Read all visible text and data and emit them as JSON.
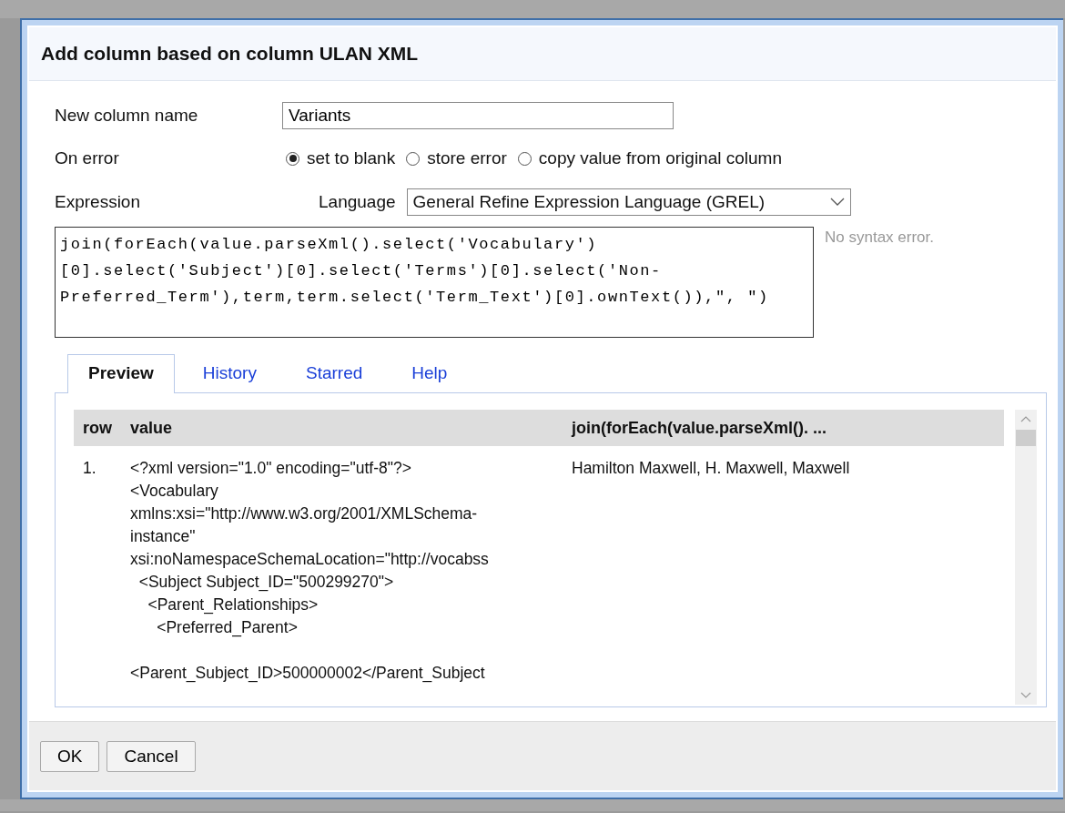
{
  "dialog": {
    "title": "Add column based on column ULAN XML",
    "new_column": {
      "label": "New column name",
      "value": "Variants"
    },
    "on_error": {
      "label": "On error",
      "options": [
        {
          "label": "set to blank",
          "selected": true
        },
        {
          "label": "store error",
          "selected": false
        },
        {
          "label": "copy value from original column",
          "selected": false
        }
      ]
    },
    "expression": {
      "label": "Expression",
      "language_label": "Language",
      "language": "General Refine Expression Language (GREL)",
      "value": "join(forEach(value.parseXml().select('Vocabulary')[0].select('Subject')[0].select('Terms')[0].select('Non-Preferred_Term'),term,term.select('Term_Text')[0].ownText()),\", \")",
      "status": "No syntax error."
    },
    "tabs": [
      {
        "label": "Preview",
        "selected": true
      },
      {
        "label": "History",
        "selected": false
      },
      {
        "label": "Starred",
        "selected": false
      },
      {
        "label": "Help",
        "selected": false
      }
    ],
    "preview": {
      "columns": [
        "row",
        "value",
        "join(forEach(value.parseXml(). ..."
      ],
      "rows": [
        {
          "row": "1.",
          "value": "<?xml version=\"1.0\" encoding=\"utf-8\"?>\n<Vocabulary\nxmlns:xsi=\"http://www.w3.org/2001/XMLSchema-\ninstance\"\nxsi:noNamespaceSchemaLocation=\"http://vocabss\n  <Subject Subject_ID=\"500299270\">\n    <Parent_Relationships>\n      <Preferred_Parent>\n\n<Parent_Subject_ID>500000002</Parent_Subject",
          "result": "Hamilton Maxwell, H. Maxwell, Maxwell"
        }
      ]
    },
    "buttons": [
      "OK",
      "Cancel"
    ]
  }
}
